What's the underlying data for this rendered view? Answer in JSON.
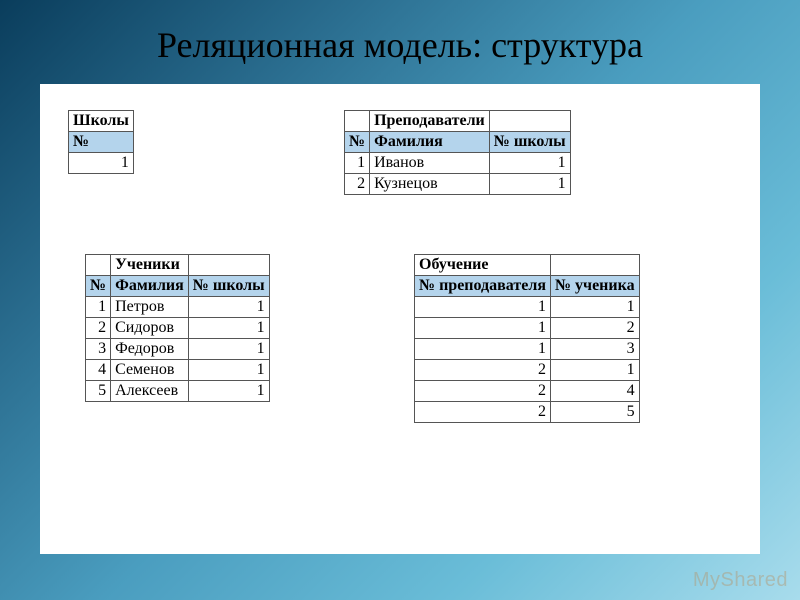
{
  "slide": {
    "title": "Реляционная модель: структура",
    "watermark": "MyShared"
  },
  "tables": {
    "schools": {
      "caption": "Школы",
      "header": {
        "num": "№"
      },
      "rows": [
        {
          "num": "1"
        }
      ]
    },
    "teachers": {
      "caption": "Преподаватели",
      "header": {
        "num": "№",
        "surname": "Фамилия",
        "school": "№ школы"
      },
      "rows": [
        {
          "num": "1",
          "surname": "Иванов",
          "school": "1"
        },
        {
          "num": "2",
          "surname": "Кузнецов",
          "school": "1"
        }
      ]
    },
    "students": {
      "caption": "Ученики",
      "header": {
        "num": "№",
        "surname": "Фамилия",
        "school": "№ школы"
      },
      "rows": [
        {
          "num": "1",
          "surname": "Петров",
          "school": "1"
        },
        {
          "num": "2",
          "surname": "Сидоров",
          "school": "1"
        },
        {
          "num": "3",
          "surname": "Федоров",
          "school": "1"
        },
        {
          "num": "4",
          "surname": "Семенов",
          "school": "1"
        },
        {
          "num": "5",
          "surname": "Алексеев",
          "school": "1"
        }
      ]
    },
    "training": {
      "caption": "Обучение",
      "header": {
        "teacher": "№ преподавателя",
        "student": "№ ученика"
      },
      "rows": [
        {
          "teacher": "1",
          "student": "1"
        },
        {
          "teacher": "1",
          "student": "2"
        },
        {
          "teacher": "1",
          "student": "3"
        },
        {
          "teacher": "2",
          "student": "1"
        },
        {
          "teacher": "2",
          "student": "4"
        },
        {
          "teacher": "2",
          "student": "5"
        }
      ]
    }
  }
}
